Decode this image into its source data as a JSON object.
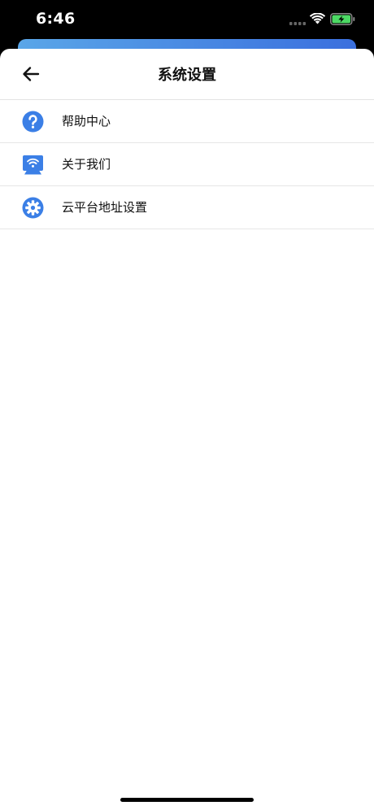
{
  "status_bar": {
    "time": "6:46"
  },
  "nav": {
    "title": "系统设置",
    "back_icon": "arrow-left-icon"
  },
  "settings": {
    "items": [
      {
        "label": "帮助中心",
        "icon": "question-circle-icon"
      },
      {
        "label": "关于我们",
        "icon": "wifi-display-icon"
      },
      {
        "label": "云平台地址设置",
        "icon": "gear-icon"
      }
    ]
  },
  "colors": {
    "accent": "#3B7FE6",
    "header_gradient_start": "#5aa6e8",
    "header_gradient_end": "#3a6fde",
    "battery_fill": "#4CD964"
  }
}
